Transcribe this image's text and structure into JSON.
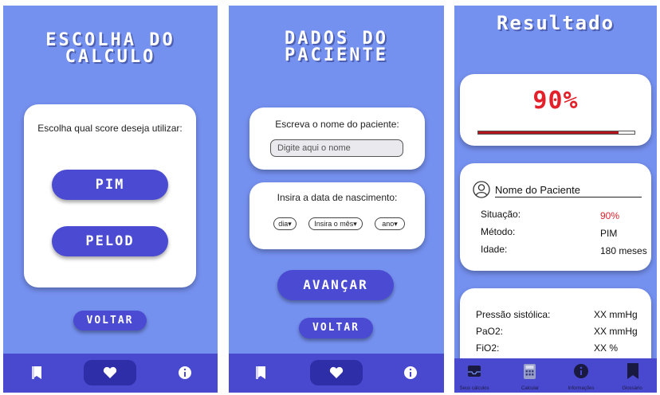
{
  "screen1": {
    "title_line1": "ESCOLHA DO",
    "title_line2": "CALCULO",
    "prompt": "Escolha qual score deseja utilizar:",
    "pim_button": "PIM",
    "pelod_button": "PELOD",
    "back_button": "VOLTAR"
  },
  "screen2": {
    "title_line1": "DADOS DO",
    "title_line2": "PACIENTE",
    "name_prompt": "Escreva o nome do paciente:",
    "name_placeholder": "Digite aqui o nome",
    "date_prompt": "Insira a data de nascimento:",
    "day_select": "dia",
    "month_select": "Insira o mês",
    "year_select": "ano",
    "advance_button": "AVANÇAR",
    "back_button": "VOLTAR"
  },
  "screen3": {
    "title": "Resultado",
    "percent": "90%",
    "progress_fraction": 0.9,
    "patient_name": "Nome do Paciente",
    "situacao_label": "Situação:",
    "situacao_value": "90%",
    "metodo_label": "Método:",
    "metodo_value": "PIM",
    "idade_label": "Idade:",
    "idade_value": "180 meses",
    "pressao_label": "Pressão sistólica:",
    "pressao_value": "XX mmHg",
    "pao2_label": "PaO2:",
    "pao2_value": "XX mmHg",
    "fio2_label": "FiO2:",
    "fio2_value": "XX %",
    "nav": {
      "calculos": "Seus cálculos",
      "calcular": "Calcular",
      "informacoes": "Informações",
      "glossario": "Glossário"
    }
  },
  "icons": [
    "book-icon",
    "heart-icon",
    "info-icon",
    "inbox-icon",
    "calculator-icon",
    "user-icon"
  ],
  "colors": {
    "background": "#7591f0",
    "nav": "#4949cf",
    "nav_active": "#2e2ea8",
    "button": "#4a4ad2",
    "result_red": "#e2212b"
  }
}
